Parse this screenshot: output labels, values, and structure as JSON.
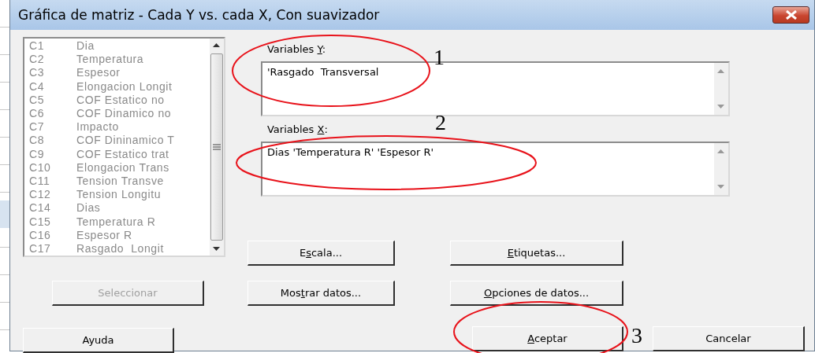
{
  "window": {
    "title": "Gráfica de matriz - Cada Y vs. cada X, Con suavizador"
  },
  "columns_list": [
    {
      "code": "C1",
      "name": "Dia"
    },
    {
      "code": "C2",
      "name": "Temperatura"
    },
    {
      "code": "C3",
      "name": "Espesor"
    },
    {
      "code": "C4",
      "name": "Elongacion Longit"
    },
    {
      "code": "C5",
      "name": "COF Estatico no"
    },
    {
      "code": "C6",
      "name": "COF Dinamico no"
    },
    {
      "code": "C7",
      "name": "Impacto"
    },
    {
      "code": "C8",
      "name": "COF Dininamico T"
    },
    {
      "code": "C9",
      "name": "COF Estatico trat"
    },
    {
      "code": "C10",
      "name": "Elongacion Trans"
    },
    {
      "code": "C11",
      "name": "Tension Transve"
    },
    {
      "code": "C12",
      "name": "Tension Longitu"
    },
    {
      "code": "C14",
      "name": "Dias"
    },
    {
      "code": "C15",
      "name": "Temperatura R"
    },
    {
      "code": "C16",
      "name": "Espesor R"
    },
    {
      "code": "C17",
      "name": "Rasgado  Longit"
    }
  ],
  "fields": [
    {
      "label": {
        "before": "Variables ",
        "key": "Y",
        "after": ":"
      },
      "value": "'Rasgado  Transversal"
    },
    {
      "label": {
        "before": "Variables ",
        "key": "X",
        "after": ":"
      },
      "value": "Dias 'Temperatura R' 'Espesor R'"
    }
  ],
  "buttons": [
    {
      "label": {
        "before": "E",
        "key": "s",
        "after": "cala..."
      },
      "disabled": false
    },
    {
      "label": {
        "key": "E",
        "after": "tiquetas..."
      },
      "disabled": false
    },
    {
      "label": {
        "before": "Seleccionar"
      },
      "disabled": true
    },
    {
      "label": {
        "before": "Mos",
        "key": "t",
        "after": "rar datos..."
      },
      "disabled": false
    },
    {
      "label": {
        "key": "O",
        "after": "pciones de datos..."
      },
      "disabled": false
    },
    {
      "label": {
        "before": "Ayuda"
      },
      "disabled": false
    },
    {
      "label": {
        "key": "A",
        "after": "ceptar"
      },
      "disabled": false
    },
    {
      "label": {
        "before": "Cancelar"
      },
      "disabled": false
    }
  ],
  "annotations": [
    "1",
    "2",
    "3"
  ]
}
